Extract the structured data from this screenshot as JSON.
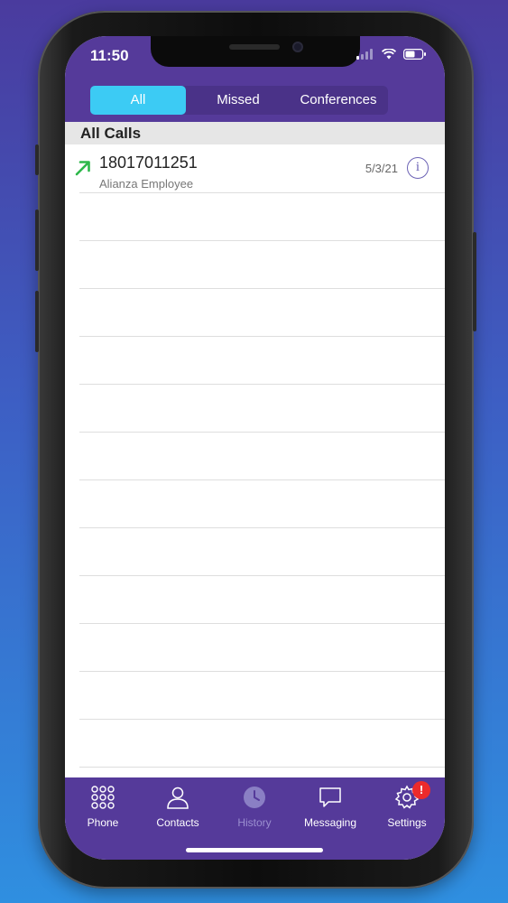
{
  "status_bar": {
    "time": "11:50"
  },
  "filter_tabs": [
    {
      "label": "All",
      "active": true
    },
    {
      "label": "Missed",
      "active": false
    },
    {
      "label": "Conferences",
      "active": false
    }
  ],
  "section": {
    "title": "All Calls"
  },
  "calls": [
    {
      "number": "18017011251",
      "name": "Alianza Employee",
      "date": "5/3/21",
      "direction": "outgoing"
    }
  ],
  "bottom_tabs": [
    {
      "label": "Phone",
      "icon": "dialpad-icon",
      "active": false
    },
    {
      "label": "Contacts",
      "icon": "contacts-icon",
      "active": false
    },
    {
      "label": "History",
      "icon": "clock-icon",
      "active": true
    },
    {
      "label": "Messaging",
      "icon": "chat-bubble-icon",
      "active": false
    },
    {
      "label": "Settings",
      "icon": "gear-icon",
      "active": false,
      "badge": "!"
    }
  ],
  "colors": {
    "header_purple": "#553a9a",
    "active_tab_cyan": "#3ccbf4",
    "outgoing_arrow_green": "#2eb84b",
    "badge_red": "#ec2b2b"
  }
}
